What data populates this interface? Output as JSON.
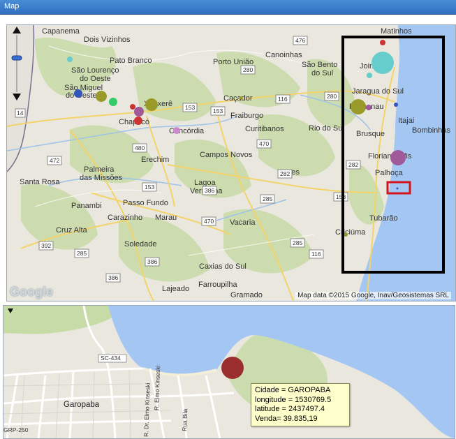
{
  "window": {
    "title": "Map"
  },
  "overview_map": {
    "attribution": "Map data ©2015 Google, Inav/Geosistemas SRL",
    "logo": "Google",
    "cities": [
      "Capanema",
      "Dois Vizinhos",
      "Pato Branco",
      "São Lourenço do Oeste",
      "São Miguel do Oeste",
      "Xanxerê",
      "Chapecó",
      "Concórdia",
      "Erechim",
      "Palmeira das Missões",
      "Santa Rosa",
      "Panambi",
      "Passo Fundo",
      "Carazinho",
      "Marau",
      "Cruz Alta",
      "Soledade",
      "Lajeado",
      "Caxias do Sul",
      "Farroupilha",
      "Gramado",
      "Porto União",
      "Canoinhas",
      "São Bento do Sul",
      "Caçador",
      "Fraiburgo",
      "Curitibanos",
      "Campos Novos",
      "Lages",
      "Lagoa Vermelha",
      "Vacaria",
      "Rio do Sul",
      "Matinhos",
      "Joinville",
      "Jaraguá do Sul",
      "Blumenau",
      "Itajaí",
      "Bombinhas",
      "Brusque",
      "Florianópolis",
      "Palhoça",
      "Tubarão",
      "Criciúma"
    ],
    "road_shields": [
      "476",
      "280",
      "116",
      "280",
      "153",
      "153",
      "480",
      "282",
      "470",
      "153",
      "386",
      "285",
      "470",
      "158",
      "285",
      "392",
      "116",
      "285",
      "386",
      "282",
      "14",
      "158",
      "285"
    ]
  },
  "detail_map": {
    "labels": {
      "city": "Garopaba",
      "road1": "SC-434",
      "road2": "GRP-250",
      "street1": "R. Elmo Kinseski",
      "street2": "R. Dr. Elmo Kinseski",
      "street3": "Rua Bila"
    }
  },
  "tooltip": {
    "line1": "Cidade = GAROPABA",
    "line2": "longitude = 1530769.5",
    "line3": "latitude = 2437497.4",
    "line4": "Venda= 39.835,19"
  },
  "colors": {
    "title_bar": "#3a7fcf",
    "ocean": "#a4c6f2",
    "land": "#e9e7de",
    "vegetation": "#c7dba6",
    "selection_box": "#000000",
    "highlight_box": "#d4141d",
    "bubble_selected": "#9b2f2f"
  },
  "icons": [
    "zoom-slider-icon",
    "pan-up-arrow-icon",
    "pan-down-arrow-icon",
    "collapse-arrow-icon"
  ]
}
